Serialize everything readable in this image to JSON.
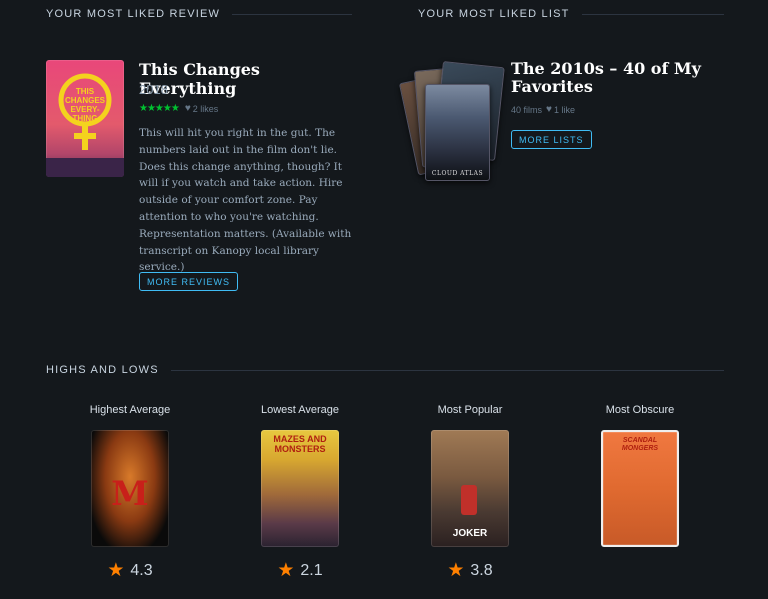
{
  "review_section": {
    "heading": "Your most liked review",
    "film_title": "This Changes Everything",
    "year": "2018",
    "stars": "★★★★★",
    "likes": "2 likes",
    "body": "This will hit you right in the gut. The numbers laid out in the film don't lie. Does this change anything, though? It will if you watch and take action. Hire outside of your comfort zone. Pay attention to who you're watching. Representation matters. (Available with transcript on Kanopy local library service.)",
    "poster_text": "THIS CHANGES EVERY-THING",
    "button": "More reviews"
  },
  "list_section": {
    "heading": "Your most liked list",
    "title": "The 2010s – 40 of My Favorites",
    "films": "40 films",
    "likes": "1 like",
    "front_poster_label": "CLOUD ATLAS",
    "button": "More lists"
  },
  "highs_lows": {
    "heading": "Highs and lows",
    "items": [
      {
        "label": "Highest Average",
        "rating": "4.3",
        "poster_text": "M"
      },
      {
        "label": "Lowest Average",
        "rating": "2.1",
        "poster_text": "MAZES AND MONSTERS"
      },
      {
        "label": "Most Popular",
        "rating": "3.8",
        "poster_text": "JOKER"
      },
      {
        "label": "Most Obscure",
        "rating": "",
        "poster_text": "SCANDAL MONGERS"
      }
    ]
  },
  "colors": {
    "background": "#14181c",
    "accent_blue": "#40bcf4",
    "star_green": "#00c030",
    "star_orange": "#ff8000"
  }
}
